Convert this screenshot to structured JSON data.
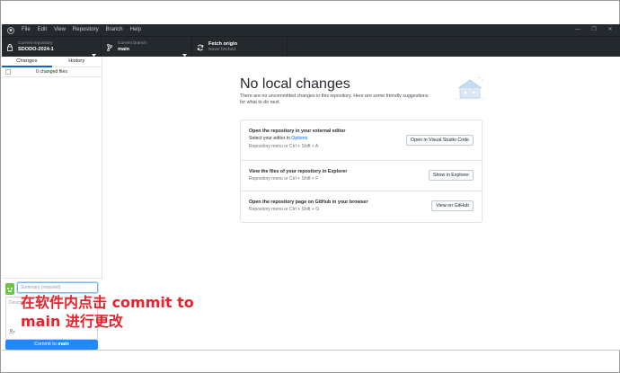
{
  "menu": {
    "items": [
      "File",
      "Edit",
      "View",
      "Repository",
      "Branch",
      "Help"
    ],
    "window_controls": [
      "—",
      "❐",
      "✕"
    ]
  },
  "toolbar": {
    "repo_label": "Current repository",
    "repo_value": "SDODO-2024-1",
    "branch_label": "Current branch",
    "branch_value": "main",
    "fetch_label": "Fetch origin",
    "fetch_value": "Never fetched"
  },
  "sidebar": {
    "tabs": [
      "Changes",
      "History"
    ],
    "changed_files": "0 changed files",
    "summary_placeholder": "Summary (required)",
    "description_placeholder": "Description",
    "commit_prefix": "Commit to ",
    "commit_branch": "main"
  },
  "annotation": {
    "line1": "在软件内点击 commit to",
    "line2": "main 进行更改"
  },
  "main": {
    "heading": "No local changes",
    "subtext": "There are no uncommitted changes in this repository. Here are some friendly suggestions for what to do next.",
    "rows": [
      {
        "title": "Open the repository in your external editor",
        "desc_prefix": "Select your editor in ",
        "desc_link": "Options",
        "hint": "Repository menu or  Ctrl + Shift + A",
        "button": "Open in Visual Studio Code"
      },
      {
        "title": "View the files of your repository in Explorer",
        "hint": "Repository menu or  Ctrl + Shift + F",
        "button": "Show in Explorer"
      },
      {
        "title": "Open the repository page on GitHub in your browser",
        "hint": "Repository menu or  Ctrl + Shift + G",
        "button": "View on GitHub"
      }
    ]
  },
  "colors": {
    "dark_bar": "#24292e",
    "accent_blue": "#2188ff",
    "annotation_red": "#e8232b"
  }
}
